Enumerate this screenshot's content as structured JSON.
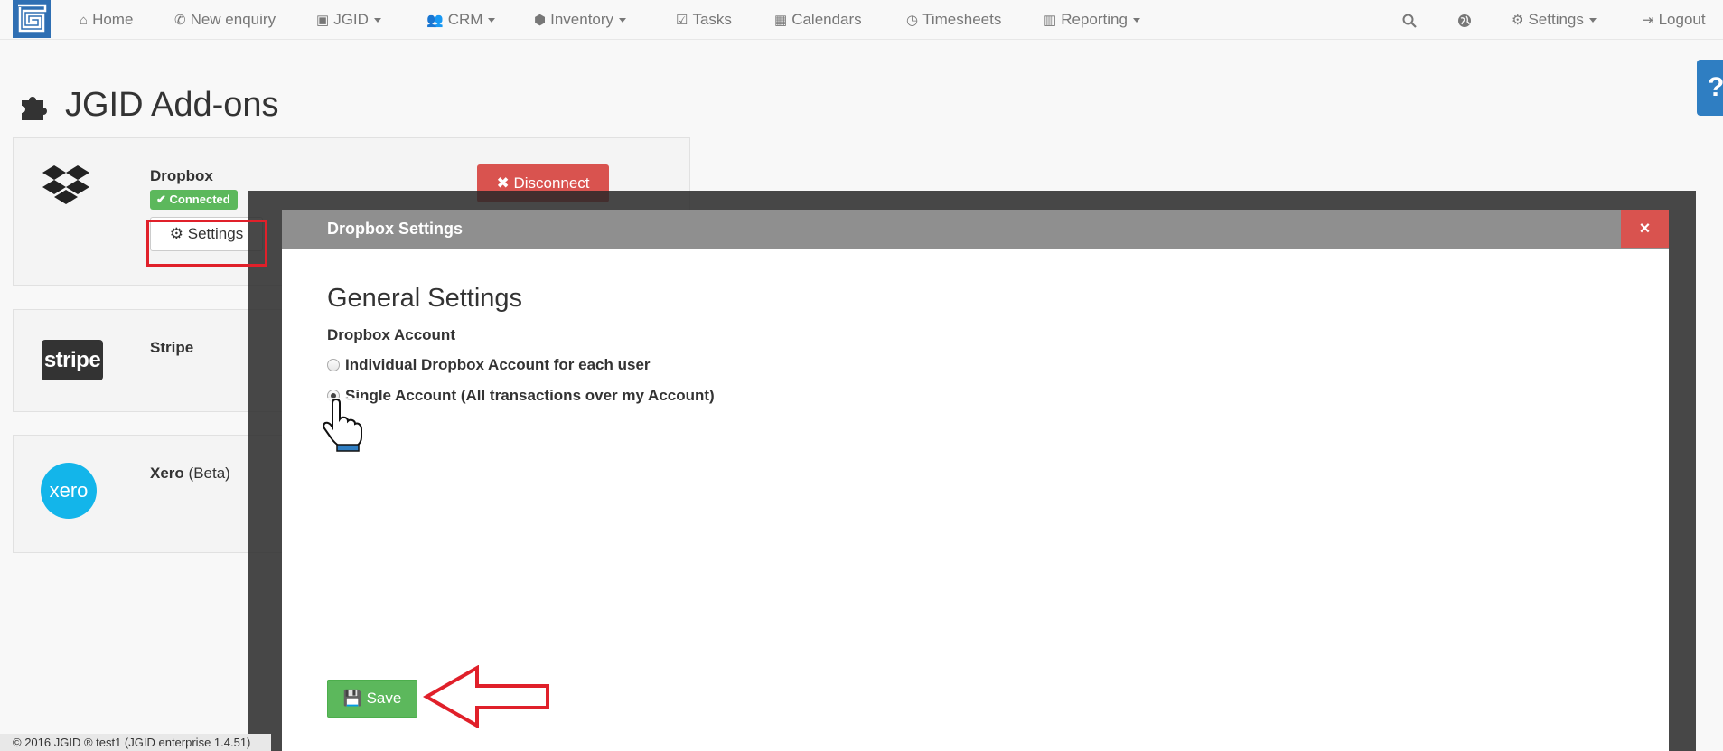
{
  "navbar": {
    "items": [
      {
        "label": "Home",
        "icon": "home-icon",
        "glyph": "⌂"
      },
      {
        "label": "New enquiry",
        "icon": "phone-icon",
        "glyph": "✆"
      },
      {
        "label": "JGID",
        "icon": "jgid-icon",
        "glyph": "▣"
      },
      {
        "label": "CRM",
        "icon": "users-icon",
        "glyph": "👥"
      },
      {
        "label": "Inventory",
        "icon": "cubes-icon",
        "glyph": "⬢"
      },
      {
        "label": "Tasks",
        "icon": "check-square-icon",
        "glyph": "☑"
      },
      {
        "label": "Calendars",
        "icon": "calendar-icon",
        "glyph": "▦"
      },
      {
        "label": "Timesheets",
        "icon": "clock-icon",
        "glyph": "◷"
      },
      {
        "label": "Reporting",
        "icon": "bar-chart-icon",
        "glyph": "▥"
      }
    ],
    "right": {
      "settings_label": "Settings",
      "logout_label": "Logout"
    }
  },
  "help": {
    "label": "?"
  },
  "page": {
    "title": "JGID Add-ons"
  },
  "addons": {
    "dropbox": {
      "name": "Dropbox",
      "status": "Connected",
      "settings_label": "Settings",
      "disconnect_label": "Disconnect"
    },
    "stripe": {
      "name": "Stripe",
      "logo_text": "stripe"
    },
    "xero": {
      "name": "Xero",
      "suffix": "(Beta)",
      "logo_text": "xero"
    }
  },
  "modal": {
    "title": "Dropbox Settings",
    "close_label": "×",
    "section_heading": "General Settings",
    "field_label": "Dropbox Account",
    "options": [
      {
        "label": "Individual Dropbox Account for each user",
        "checked": false
      },
      {
        "label": "Single Account (All transactions over my Account)",
        "checked": true
      }
    ],
    "save_label": "Save"
  },
  "footer": {
    "text": "© 2016 JGID ® test1 (JGID enterprise 1.4.51)"
  },
  "colors": {
    "brand_blue": "#2f6fb3",
    "success": "#5cb85c",
    "danger": "#d9534f",
    "annotation_red": "#e0202a"
  }
}
